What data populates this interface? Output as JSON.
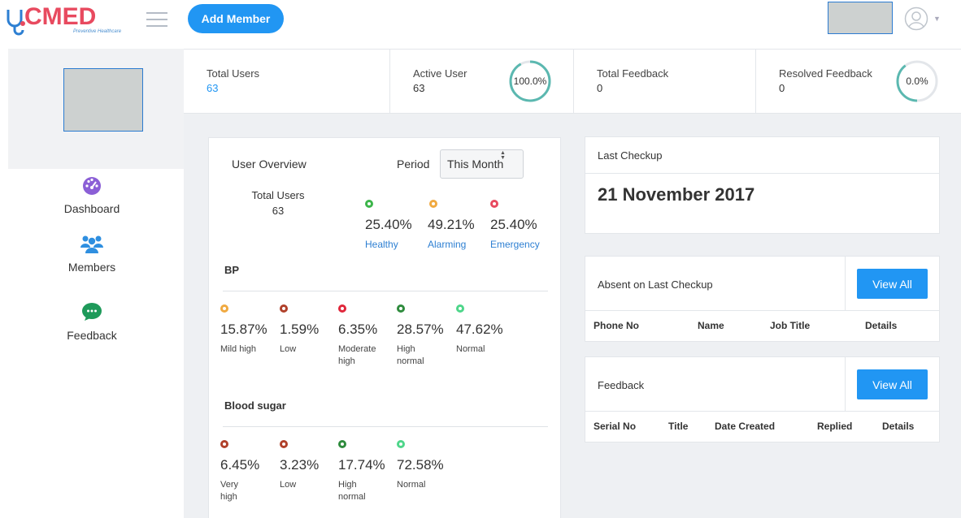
{
  "header": {
    "logo_text": "CMED",
    "logo_tagline": "Preventive Healthcare",
    "add_member_label": "Add Member"
  },
  "sidebar": {
    "items": [
      {
        "label": "Dashboard",
        "icon": "dashboard-gauge-icon",
        "color": "#8b5fd6"
      },
      {
        "label": "Members",
        "icon": "members-group-icon",
        "color": "#2f8fe0"
      },
      {
        "label": "Feedback",
        "icon": "feedback-chat-icon",
        "color": "#1e9a5a"
      }
    ]
  },
  "stats": {
    "total_users": {
      "title": "Total Users",
      "value": "63"
    },
    "active_user": {
      "title": "Active User",
      "value": "63",
      "ring_label": "100.0%",
      "ring_fraction": 1.0
    },
    "total_feedback": {
      "title": "Total Feedback",
      "value": "0"
    },
    "resolved_feedback": {
      "title": "Resolved Feedback",
      "value": "0",
      "ring_label": "0.0%",
      "ring_fraction": 0.0
    }
  },
  "overview": {
    "title": "User Overview",
    "period_label": "Period",
    "period_value": "This Month",
    "total_users_label": "Total Users",
    "total_users_value": "63",
    "summary": [
      {
        "pct": "25.40%",
        "label": "Healthy",
        "color": "#3cb54a"
      },
      {
        "pct": "49.21%",
        "label": "Alarming",
        "color": "#f0a940"
      },
      {
        "pct": "25.40%",
        "label": "Emergency",
        "color": "#e84a5f"
      }
    ],
    "bp": {
      "title": "BP",
      "items": [
        {
          "pct": "15.87%",
          "label": "Mild high",
          "color": "#f0a940"
        },
        {
          "pct": "1.59%",
          "label": "Low",
          "color": "#b0402a"
        },
        {
          "pct": "6.35%",
          "label": "Moderate high",
          "color": "#e0263a"
        },
        {
          "pct": "28.57%",
          "label": "High normal",
          "color": "#2e8b3d"
        },
        {
          "pct": "47.62%",
          "label": "Normal",
          "color": "#4ed68a"
        }
      ]
    },
    "sugar": {
      "title": "Blood sugar",
      "items": [
        {
          "pct": "6.45%",
          "label": "Very high",
          "color": "#b0402a"
        },
        {
          "pct": "3.23%",
          "label": "Low",
          "color": "#b0402a"
        },
        {
          "pct": "17.74%",
          "label": "High normal",
          "color": "#2e8b3d"
        },
        {
          "pct": "72.58%",
          "label": "Normal",
          "color": "#4ed68a"
        }
      ]
    }
  },
  "last_checkup": {
    "title": "Last Checkup",
    "date": "21 November 2017"
  },
  "absent": {
    "title": "Absent on Last Checkup",
    "button": "View All",
    "columns": [
      "Phone No",
      "Name",
      "Job Title",
      "Details"
    ]
  },
  "feedback": {
    "title": "Feedback",
    "button": "View All",
    "columns": [
      "Serial No",
      "Title",
      "Date Created",
      "Replied",
      "Details"
    ]
  },
  "colors": {
    "primary": "#2196f3",
    "ring": "#5bb8b0",
    "logo": "#e84a5f"
  }
}
